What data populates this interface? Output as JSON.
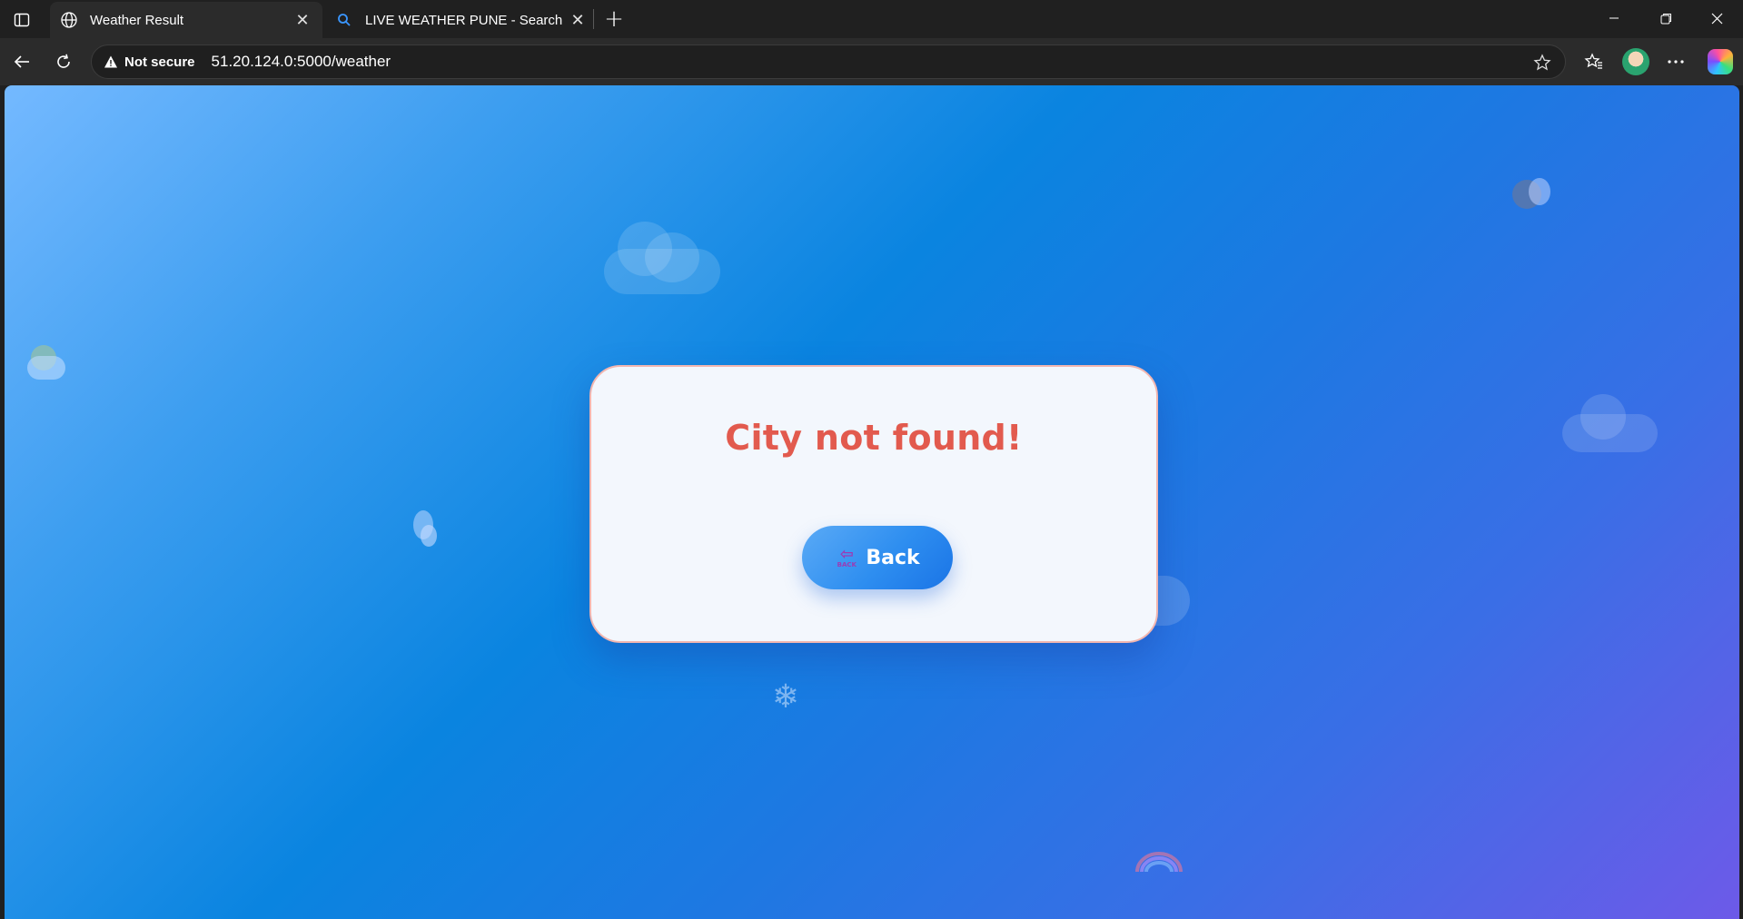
{
  "browser": {
    "tabs": [
      {
        "title": "Weather Result",
        "active": true,
        "icon": "globe-icon"
      },
      {
        "title": "LIVE WEATHER PUNE - Search",
        "active": false,
        "icon": "search-icon"
      }
    ],
    "address": {
      "security_label": "Not secure",
      "url": "51.20.124.0:5000/weather"
    }
  },
  "page": {
    "error_message": "City not found!",
    "back_button_label": "Back",
    "back_icon_caption": "BACK",
    "background_colors": [
      "#74b9ff",
      "#0a84e0",
      "#6d5ae8"
    ],
    "error_color": "#e25a4e"
  }
}
